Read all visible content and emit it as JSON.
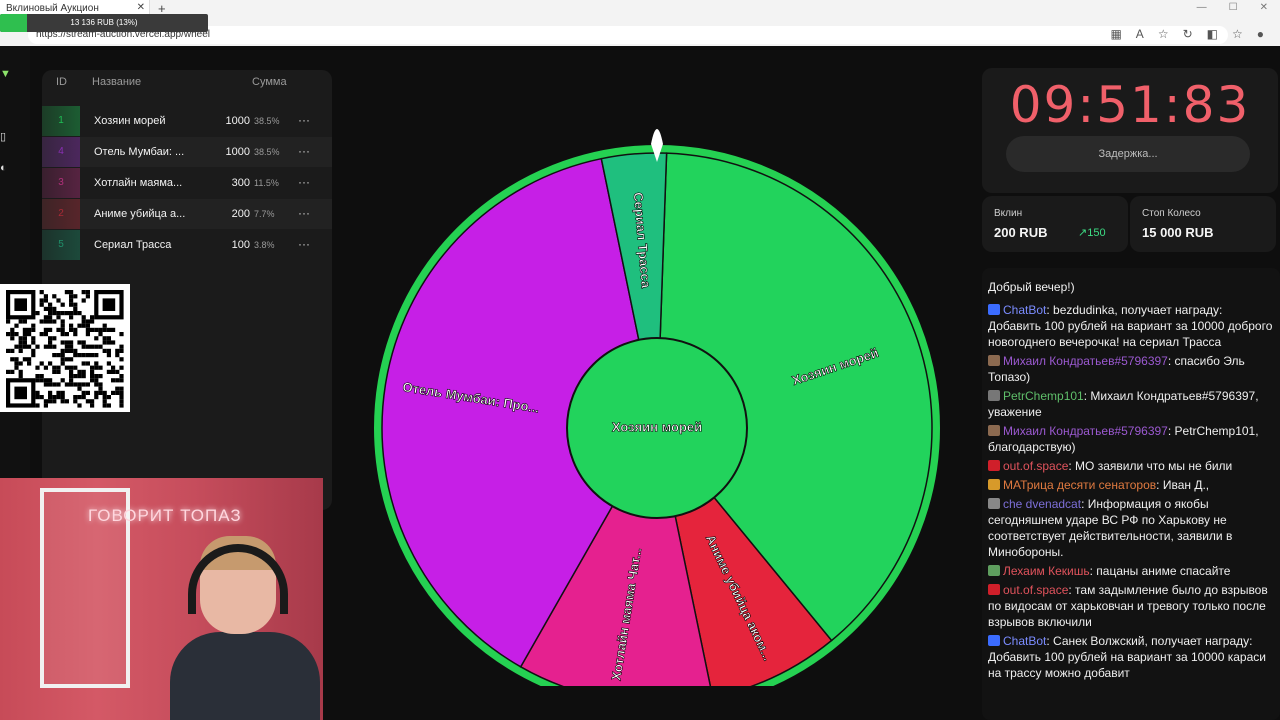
{
  "browser": {
    "tab_title": "Вклиновый Аукцион",
    "tab_close": "✕",
    "new_tab": "+",
    "url": "https://stream-auction.vercel.app/wheel",
    "obs_overlay": {
      "text": "13 136 RUB (13%)",
      "progress": 0.13
    }
  },
  "lots": {
    "headers": {
      "id": "ID",
      "name": "Название",
      "sum": "Сумма"
    },
    "rows": [
      {
        "id": "1",
        "name": "Хозяин морей",
        "sum": "1000",
        "pct": "38.5%",
        "color": "#1fbf55",
        "menu": "···"
      },
      {
        "id": "4",
        "name": "Отель Мумбаи: ...",
        "sum": "1000",
        "pct": "38.5%",
        "color": "#8a2fb5",
        "menu": "···"
      },
      {
        "id": "3",
        "name": "Хотлайн маяма...",
        "sum": "300",
        "pct": "11.5%",
        "color": "#b0307a",
        "menu": "···"
      },
      {
        "id": "2",
        "name": "Аниме убийца а...",
        "sum": "200",
        "pct": "7.7%",
        "color": "#a82a36",
        "menu": "···"
      },
      {
        "id": "5",
        "name": "Сериал Трасса",
        "sum": "100",
        "pct": "3.8%",
        "color": "#1f8f6a",
        "menu": "···"
      }
    ]
  },
  "wheel": {
    "center_label": "Хозяин морей",
    "segments": [
      {
        "label": "Хозяин морей",
        "value": 38.5,
        "color": "#22d35c"
      },
      {
        "label": "Аниме убийца аком...",
        "value": 7.7,
        "color": "#e5243c"
      },
      {
        "label": "Хотлайн маяма Чат...",
        "value": 11.5,
        "color": "#e5218f"
      },
      {
        "label": "Отель Мумбаи: Про...",
        "value": 38.5,
        "color": "#c61fe6"
      },
      {
        "label": "Сериал Трасса",
        "value": 3.8,
        "color": "#1fbf7e"
      }
    ],
    "rim_color": "#25d152"
  },
  "timer": {
    "value": "09:51:83",
    "delay_label": "Задержка..."
  },
  "stats": {
    "vklin_label": "Вклин",
    "vklin_value": "200 RUB",
    "vklin_trend": "150",
    "vklin_trend_icon": "trend-up-icon",
    "stop_label": "Стоп Колесо",
    "stop_value": "15 000 RUB"
  },
  "chat": {
    "top_line": "Добрый вечер!)",
    "messages": [
      {
        "user": "ChatBot",
        "user_color": "#7b8cff",
        "badge": "#3b6cff",
        "text": ": bezdudinka, получает награду: Добавить 100 рублей на вариант за 10000 доброго новогоднего вечерочка! на сериал Трасса"
      },
      {
        "user": "Михаил Кондратьев#5796397",
        "user_color": "#9b59d0",
        "badge": "#8c6a50",
        "text": ": спасибо Эль Топазо)"
      },
      {
        "user": "PetrChemp101",
        "user_color": "#5fbf6a",
        "badge": "#777777",
        "text": ": Михаил Кондратьев#5796397, уважение"
      },
      {
        "user": "Михаил Кондратьев#5796397",
        "user_color": "#9b59d0",
        "badge": "#8c6a50",
        "text": ": PetrChemp101, благодарствую)"
      },
      {
        "user": "out.of.space",
        "user_color": "#e0535c",
        "badge": "#d01f2a",
        "text": ": МО заявили что мы не били"
      },
      {
        "user": "МАТрица десяти сенаторов",
        "user_color": "#e07a40",
        "badge": "#d79a2a",
        "text": ": Иван Д.,"
      },
      {
        "user": "che dvenadcat",
        "user_color": "#7d6fd8",
        "badge": "#888888",
        "text": ": Информация о якобы сегодняшнем ударе ВС РФ по Харькову не соответствует действительности, заявили в Минобороны."
      },
      {
        "user": "Лехаим Кекишь",
        "user_color": "#e0535c",
        "badge": "#5f9f5f",
        "text": ": пацаны аниме спасайте"
      },
      {
        "user": "out.of.space",
        "user_color": "#e0535c",
        "badge": "#d01f2a",
        "text": ": там задымление было до взрывов по видосам от харьковчан и тревогу только после взрывов включили"
      },
      {
        "user": "ChatBot",
        "user_color": "#7b8cff",
        "badge": "#3b6cff",
        "text": ": Санек Волжский, получает награду: Добавить 100 рублей на вариант за 10000 караси на трассу можно добавит"
      }
    ]
  },
  "webcam": {
    "sign": "ГОВОРИТ ТОПАЗ"
  }
}
